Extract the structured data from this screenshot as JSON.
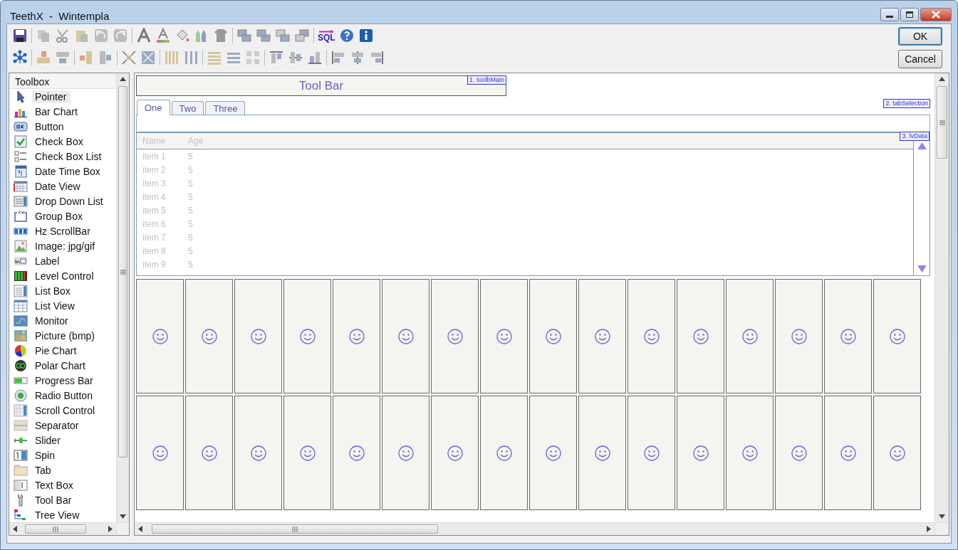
{
  "window": {
    "title": "TeethX  -  Wintempla"
  },
  "toolbar": {
    "sql_label": "SQL"
  },
  "buttons": [
    {
      "label": "OK",
      "selected": true
    },
    {
      "label": "Cancel",
      "selected": false
    }
  ],
  "toolbox": {
    "title": "Toolbox",
    "items": [
      {
        "label": "Pointer",
        "selected": true
      },
      {
        "label": "Bar Chart",
        "selected": false
      },
      {
        "label": "Button",
        "selected": false
      },
      {
        "label": "Check Box",
        "selected": false
      },
      {
        "label": "Check Box List",
        "selected": false
      },
      {
        "label": "Date Time Box",
        "selected": false
      },
      {
        "label": "Date View",
        "selected": false
      },
      {
        "label": "Drop Down List",
        "selected": false
      },
      {
        "label": "Group Box",
        "selected": false
      },
      {
        "label": "Hz ScrollBar",
        "selected": false
      },
      {
        "label": "Image: jpg/gif",
        "selected": false
      },
      {
        "label": "Label",
        "selected": false
      },
      {
        "label": "Level Control",
        "selected": false
      },
      {
        "label": "List Box",
        "selected": false
      },
      {
        "label": "List View",
        "selected": false
      },
      {
        "label": "Monitor",
        "selected": false
      },
      {
        "label": "Picture (bmp)",
        "selected": false
      },
      {
        "label": "Pie Chart",
        "selected": false
      },
      {
        "label": "Polar Chart",
        "selected": false
      },
      {
        "label": "Progress Bar",
        "selected": false
      },
      {
        "label": "Radio Button",
        "selected": false
      },
      {
        "label": "Scroll Control",
        "selected": false
      },
      {
        "label": "Separator",
        "selected": false
      },
      {
        "label": "Slider",
        "selected": false
      },
      {
        "label": "Spin",
        "selected": false
      },
      {
        "label": "Tab",
        "selected": false
      },
      {
        "label": "Text Box",
        "selected": false
      },
      {
        "label": "Tool Bar",
        "selected": false
      },
      {
        "label": "Tree View",
        "selected": false
      }
    ]
  },
  "canvas": {
    "toolbar_control": {
      "label": "Tool Bar",
      "tag": "1. toolbMain"
    },
    "tab_control": {
      "tag": "2. tabSelection",
      "tabs": [
        {
          "label": "One",
          "selected": true
        },
        {
          "label": "Two",
          "selected": false
        },
        {
          "label": "Three",
          "selected": false
        }
      ]
    },
    "list_view": {
      "tag": "3. lvData",
      "columns": [
        "Name",
        "Age"
      ],
      "rows": [
        [
          "item 1",
          "5"
        ],
        [
          "item 2",
          "5"
        ],
        [
          "item 3",
          "5"
        ],
        [
          "item 4",
          "5"
        ],
        [
          "item 5",
          "5"
        ],
        [
          "item 6",
          "5"
        ],
        [
          "item 7",
          "5"
        ],
        [
          "item 8",
          "5"
        ],
        [
          "item 9",
          "5"
        ]
      ]
    },
    "tiles": [
      {
        "kind": "smiley"
      },
      {
        "kind": "smiley"
      },
      {
        "kind": "smiley"
      },
      {
        "kind": "smiley"
      },
      {
        "kind": "smiley"
      },
      {
        "kind": "smiley"
      },
      {
        "kind": "smiley"
      },
      {
        "kind": "smiley"
      },
      {
        "kind": "smiley"
      },
      {
        "kind": "smiley"
      },
      {
        "kind": "smiley"
      },
      {
        "kind": "smiley"
      },
      {
        "kind": "smiley"
      },
      {
        "kind": "smiley"
      },
      {
        "kind": "smiley"
      },
      {
        "kind": "smiley"
      },
      {
        "kind": "smiley"
      },
      {
        "kind": "smiley"
      },
      {
        "kind": "smiley"
      },
      {
        "kind": "smiley"
      },
      {
        "kind": "smiley"
      },
      {
        "kind": "smiley"
      },
      {
        "kind": "smiley"
      },
      {
        "kind": "smiley"
      },
      {
        "kind": "smiley"
      },
      {
        "kind": "smiley"
      },
      {
        "kind": "smiley"
      },
      {
        "kind": "smiley"
      },
      {
        "kind": "smiley"
      },
      {
        "kind": "smiley"
      },
      {
        "kind": "smiley"
      },
      {
        "kind": "smiley"
      }
    ]
  }
}
